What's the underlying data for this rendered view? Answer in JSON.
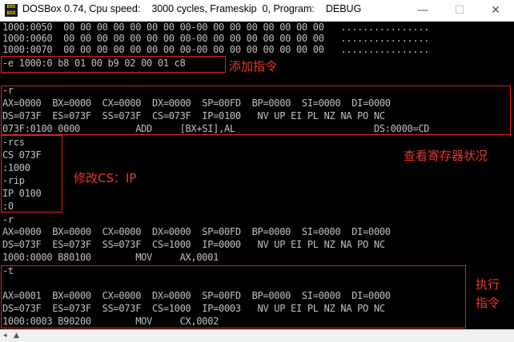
{
  "window": {
    "title_app": "DOSBox 0.74, Cpu speed:",
    "title_cycles": "3000 cycles, Frameskip  0, Program:",
    "title_program": "DEBUG",
    "minimize_glyph": "—",
    "maximize_glyph": "☐",
    "close_glyph": "✕",
    "icon_text": "DOS BOX"
  },
  "console": {
    "lines": [
      "1000:0050  00 00 00 00 00 00 00 00-00 00 00 00 00 00 00 00   ................",
      "1000:0060  00 00 00 00 00 00 00 00-00 00 00 00 00 00 00 00   ................",
      "1000:0070  00 00 00 00 00 00 00 00-00 00 00 00 00 00 00 00   ................",
      "-e 1000:0 b8 01 00 b9 02 00 01 c8",
      "",
      "-r",
      "AX=0000  BX=0000  CX=0000  DX=0000  SP=00FD  BP=0000  SI=0000  DI=0000",
      "DS=073F  ES=073F  SS=073F  CS=073F  IP=0100   NV UP EI PL NZ NA PO NC",
      "073F:0100 0000          ADD     [BX+SI],AL                         DS:0000=CD",
      "-rcs",
      "CS 073F",
      ":1000",
      "-rip",
      "IP 0100",
      ":0",
      "-r",
      "AX=0000  BX=0000  CX=0000  DX=0000  SP=00FD  BP=0000  SI=0000  DI=0000",
      "DS=073F  ES=073F  SS=073F  CS=1000  IP=0000   NV UP EI PL NZ NA PO NC",
      "1000:0000 B80100        MOV     AX,0001",
      "-t",
      "",
      "AX=0001  BX=0000  CX=0000  DX=0000  SP=00FD  BP=0000  SI=0000  DI=0000",
      "DS=073F  ES=073F  SS=073F  CS=1000  IP=0003   NV UP EI PL NZ NA PO NC",
      "1000:0003 B90200        MOV     CX,0002",
      "-"
    ]
  },
  "annotations": {
    "add_instruction": "添加指令",
    "view_registers": "查看寄存器状况",
    "modify_cs_ip": "修改CS：IP",
    "execute_line1": "执行",
    "execute_line2": "指令"
  },
  "colors": {
    "console_bg": "#000000",
    "console_text": "#c0c0c0",
    "annotation": "#e63a2a"
  },
  "statusbar": {
    "left_arrow": "◂",
    "up_arrow": "▲"
  }
}
